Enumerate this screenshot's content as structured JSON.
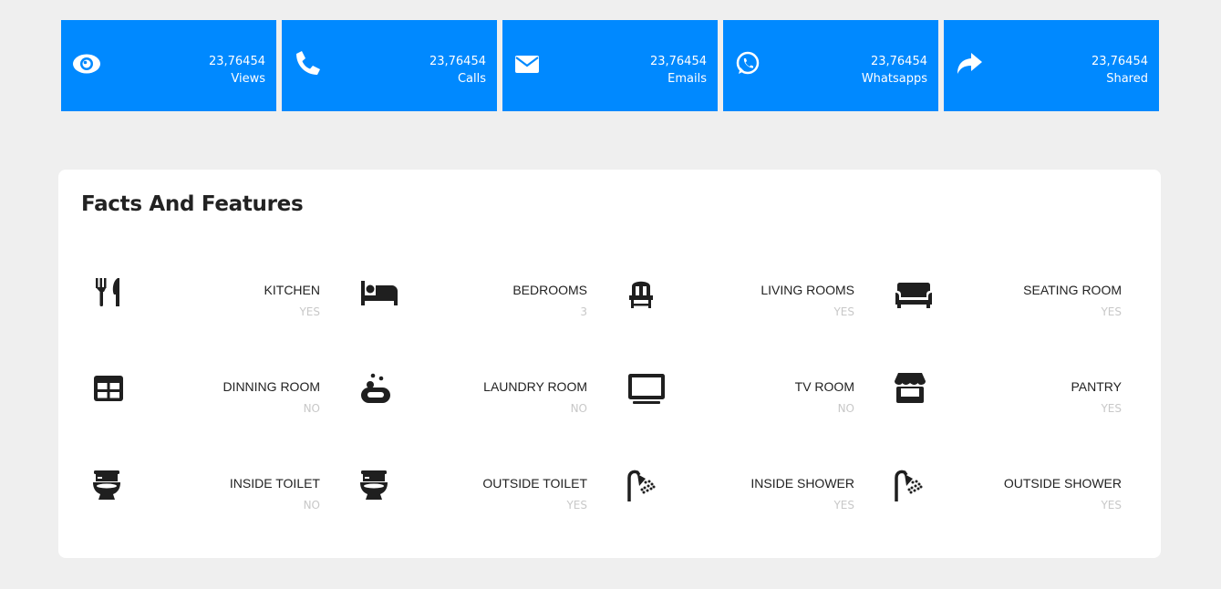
{
  "colors": {
    "accent": "#0089ff",
    "icon": "#1f1f1f",
    "muted": "#c8c8c8"
  },
  "stats": [
    {
      "icon": "eye-icon",
      "count": "23,76454",
      "label": "Views"
    },
    {
      "icon": "phone-icon",
      "count": "23,76454",
      "label": "Calls"
    },
    {
      "icon": "envelope-icon",
      "count": "23,76454",
      "label": "Emails"
    },
    {
      "icon": "whatsapp-icon",
      "count": "23,76454",
      "label": "Whatsapps"
    },
    {
      "icon": "share-icon",
      "count": "23,76454",
      "label": "Shared"
    }
  ],
  "features": {
    "title": "Facts And Features",
    "items": [
      {
        "icon": "utensils-icon",
        "label": "KITCHEN",
        "value": "YES"
      },
      {
        "icon": "bed-icon",
        "label": "BEDROOMS",
        "value": "3"
      },
      {
        "icon": "chair-icon",
        "label": "LIVING ROOMS",
        "value": "YES"
      },
      {
        "icon": "couch-icon",
        "label": "SEATING ROOM",
        "value": "YES"
      },
      {
        "icon": "table-icon",
        "label": "DINNING ROOM",
        "value": "NO"
      },
      {
        "icon": "soap-icon",
        "label": "LAUNDRY ROOM",
        "value": "NO"
      },
      {
        "icon": "tv-icon",
        "label": "TV ROOM",
        "value": "NO"
      },
      {
        "icon": "store-icon",
        "label": "PANTRY",
        "value": "YES"
      },
      {
        "icon": "toilet-icon",
        "label": "INSIDE TOILET",
        "value": "NO"
      },
      {
        "icon": "toilet-icon",
        "label": "OUTSIDE TOILET",
        "value": "YES"
      },
      {
        "icon": "shower-icon",
        "label": "INSIDE SHOWER",
        "value": "YES"
      },
      {
        "icon": "shower-icon",
        "label": "OUTSIDE SHOWER",
        "value": "YES"
      }
    ]
  }
}
